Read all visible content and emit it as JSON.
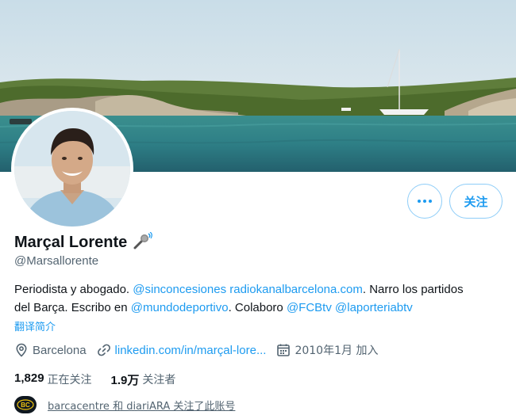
{
  "profile": {
    "display_name": "Marçal Lorente",
    "handle": "@Marsallorente",
    "follow_label": "关注",
    "bio": {
      "intro": "Periodista y abogado.",
      "mention_sinconcesiones": "@sinconcesiones",
      "link_radiokanal": "radiokanalbarcelona.com",
      "text_narro": ". Narro los partidos",
      "text_barca": "del Barça. Escribo en",
      "mention_mundodeportivo": "@mundodeportivo",
      "text_colaboro": ". Colaboro",
      "mention_fcbtv": "@FCBtv",
      "mention_laporteriabtv": "@laporteriabtv"
    },
    "translate_label": "翻译简介",
    "location": "Barcelona",
    "website": "linkedin.com/in/marçal-lore...",
    "joined": "2010年1月 加入",
    "following_count": "1,829",
    "following_label": "正在关注",
    "followers_count": "1.9万",
    "followers_label": "关注者",
    "followed_by": "barcacentre 和 diariARA 关注了此账号",
    "followed_by_avatar_text": "BC"
  },
  "icons": {
    "more": "more-dots-icon",
    "name_badge": "microphone-icon",
    "location": "location-pin-icon",
    "website": "link-icon",
    "joined": "calendar-icon"
  },
  "colors": {
    "accent": "#1d9bf0",
    "secondary_text": "#536471",
    "primary_text": "#0f1419"
  }
}
